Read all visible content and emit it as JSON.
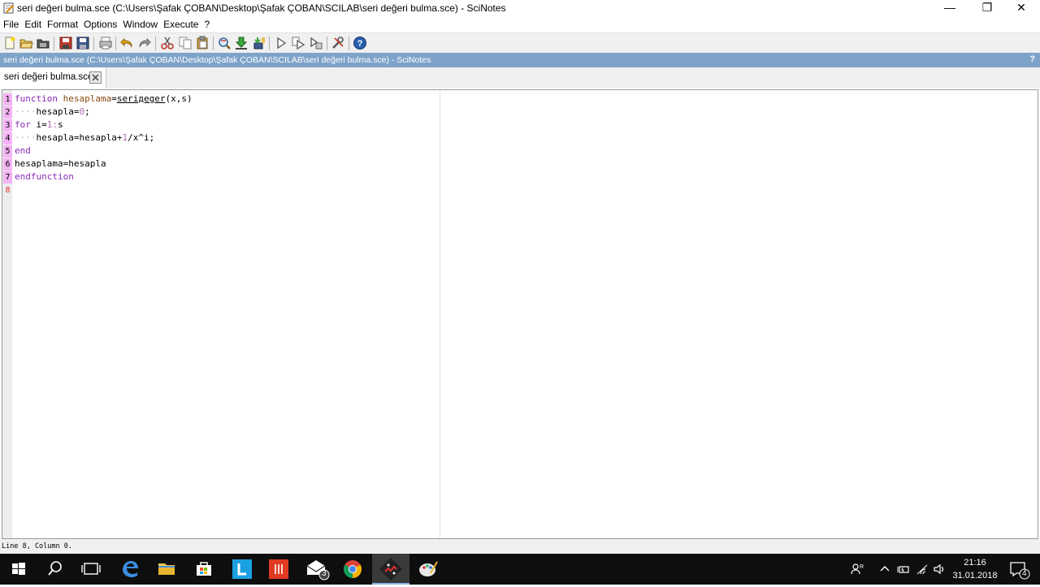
{
  "window": {
    "title": "seri değeri bulma.sce (C:\\Users\\Şafak ÇOBAN\\Desktop\\Şafak ÇOBAN\\SCILAB\\seri değeri bulma.sce) - SciNotes",
    "minimize_glyph": "—",
    "maximize_glyph": "❐",
    "close_glyph": "✕"
  },
  "menu": {
    "file": "File",
    "edit": "Edit",
    "format": "Format",
    "options": "Options",
    "window": "Window",
    "execute": "Execute",
    "help": "?"
  },
  "toolbar": {
    "icons": [
      "new-file-icon",
      "open-file-icon",
      "open-folder-icon",
      "save-icon",
      "save-as-icon",
      "print-icon",
      "undo-icon",
      "redo-icon",
      "cut-icon",
      "copy-icon",
      "paste-icon",
      "find-icon",
      "load-into-scilab-icon",
      "save-and-execute-icon",
      "execute-icon",
      "execute-all-icon",
      "execute-selection-icon",
      "tools-icon",
      "help-icon"
    ]
  },
  "pathbar": {
    "text": "seri değeri bulma.sce (C:\\Users\\Şafak ÇOBAN\\Desktop\\Şafak ÇOBAN\\SCILAB\\seri değeri bulma.sce) - SciNotes",
    "help": "?"
  },
  "tab": {
    "label": "seri değeri bulma.sce"
  },
  "editor": {
    "line_numbers": [
      "1",
      "2",
      "3",
      "4",
      "5",
      "6",
      "7",
      "8"
    ],
    "code": {
      "l1_kw": "function",
      "l1_out": "hesaplama",
      "l1_eq": "=",
      "l1_fn": "seriдeger",
      "l1_args": "(x,s)",
      "l2_indent": "····",
      "l2_var": "hesapla",
      "l2_eq": "=",
      "l2_num": "0",
      "l2_end": ";",
      "l3_kw": "for",
      "l3_var": " i=",
      "l3_start": "1",
      "l3_colon": ":",
      "l3_stop": "s",
      "l4_indent": "····",
      "l4_expr": "hesapla=hesapla+",
      "l4_num": "1",
      "l4_rest": "/x^i;",
      "l5_kw": "end",
      "l6_text": "hesaplama=hesapla",
      "l7_kw": "endfunction"
    }
  },
  "status": {
    "text": "Line 8, Column 0."
  },
  "taskbar": {
    "mail_badge": "3",
    "time": "21:16",
    "date": "31.01.2018",
    "notifications": "4"
  },
  "colors": {
    "pathbar": "#7ea3c9",
    "keyword": "#8a2bb8",
    "function_name": "#8b4a10",
    "number": "#b06cb0",
    "active_line": "#f4b3f4"
  }
}
